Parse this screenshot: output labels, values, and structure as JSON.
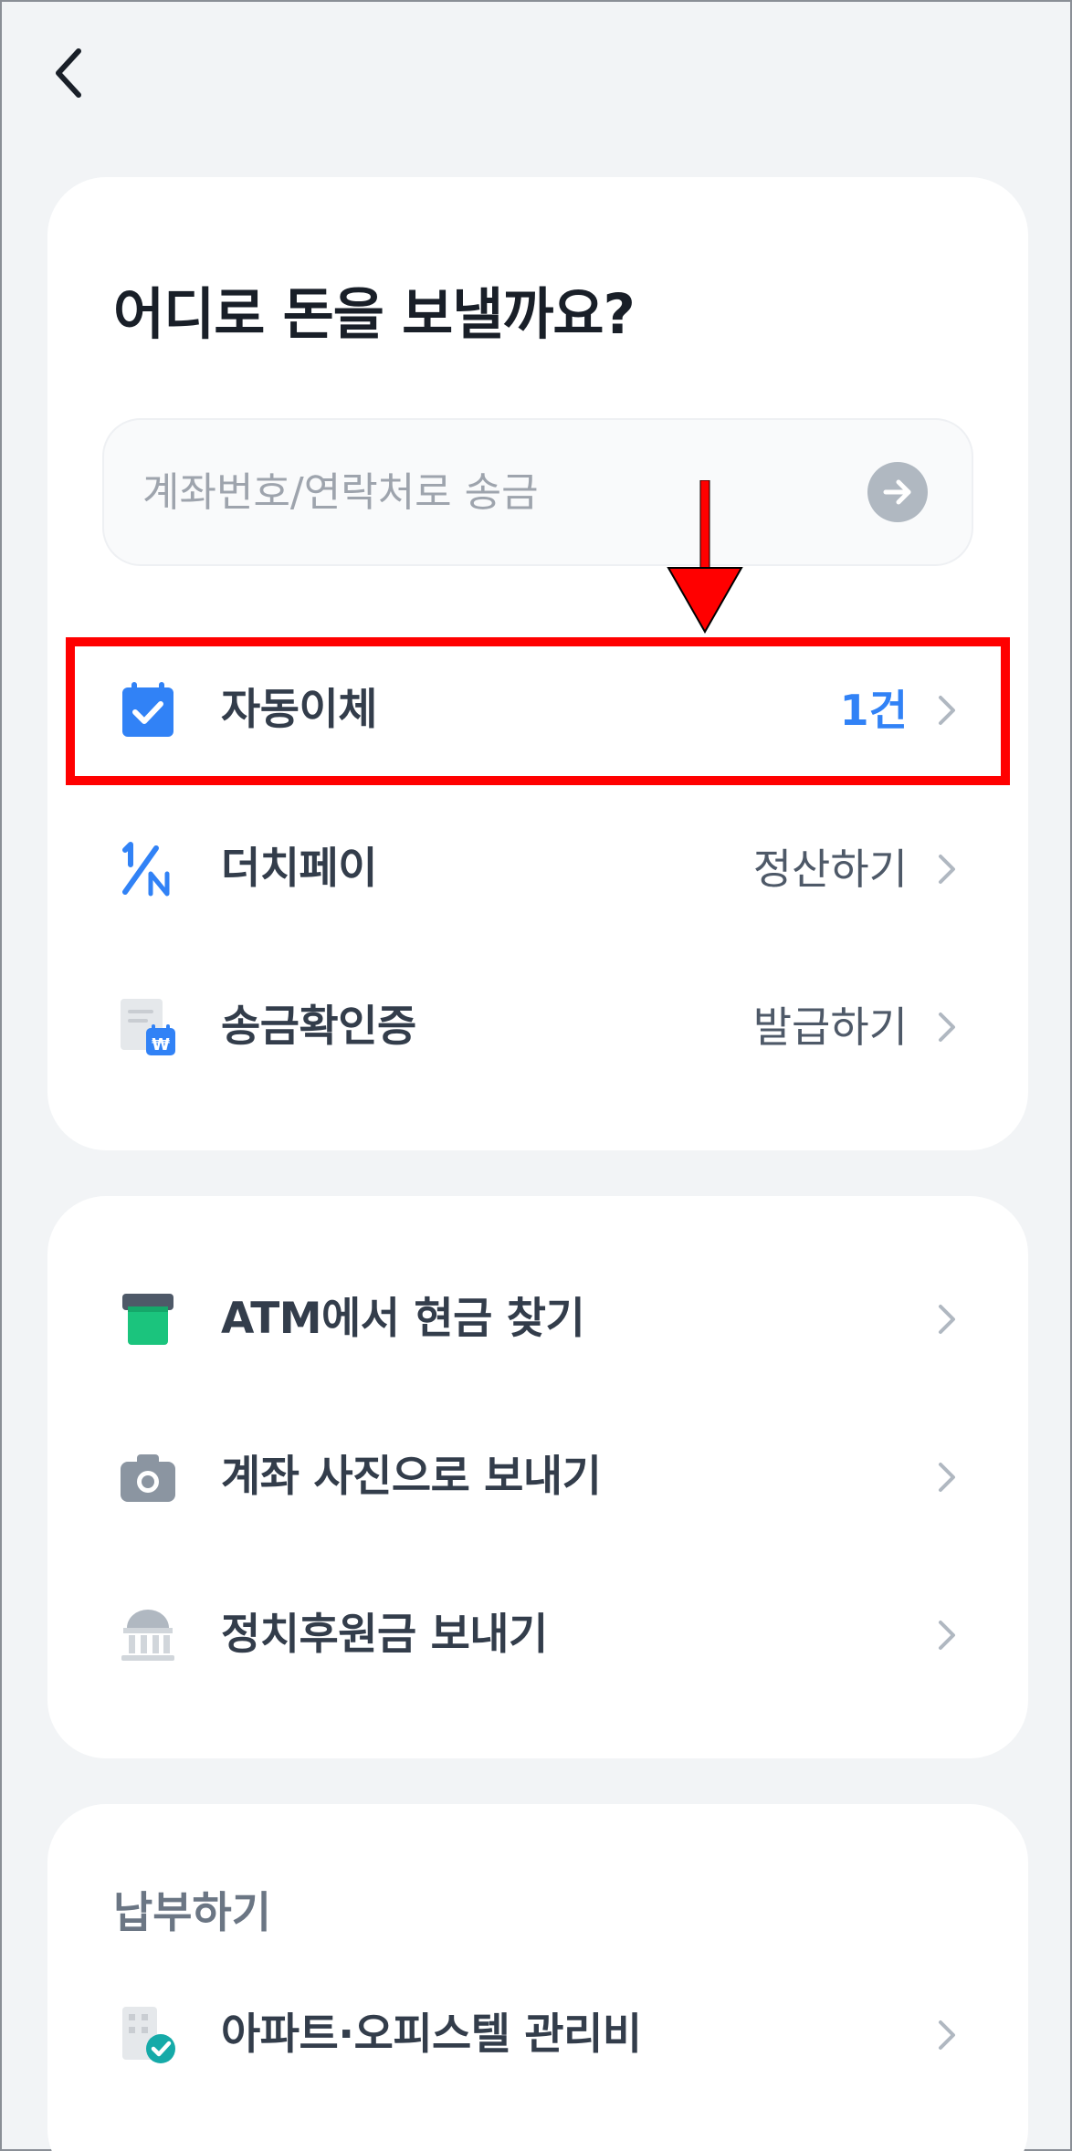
{
  "header": {
    "back_icon": "chevron-left-icon"
  },
  "transfer": {
    "headline": "어디로 돈을 보낼까요?",
    "search_placeholder": "계좌번호/연락처로 송금",
    "search_value": "",
    "go_icon": "arrow-right-circle-icon",
    "items": [
      {
        "label": "자동이체",
        "value": "1건",
        "icon": "calendar-check-icon"
      },
      {
        "label": "더치페이",
        "value": "정산하기",
        "icon": "one-over-n-icon"
      },
      {
        "label": "송금확인증",
        "value": "발급하기",
        "icon": "receipt-won-icon"
      }
    ]
  },
  "more": {
    "items": [
      {
        "label": "ATM에서 현금 찾기",
        "icon": "atm-icon"
      },
      {
        "label": "계좌 사진으로 보내기",
        "icon": "camera-icon"
      },
      {
        "label": "정치후원금 보내기",
        "icon": "government-building-icon"
      }
    ]
  },
  "payments": {
    "section_title": "납부하기",
    "items": [
      {
        "label": "아파트·오피스텔 관리비",
        "icon": "building-check-icon"
      }
    ]
  },
  "colors": {
    "background": "#f2f4f6",
    "card": "#ffffff",
    "accent_blue": "#3182f6",
    "highlight_red": "#ff0000",
    "atm_green": "#1bc47d"
  }
}
